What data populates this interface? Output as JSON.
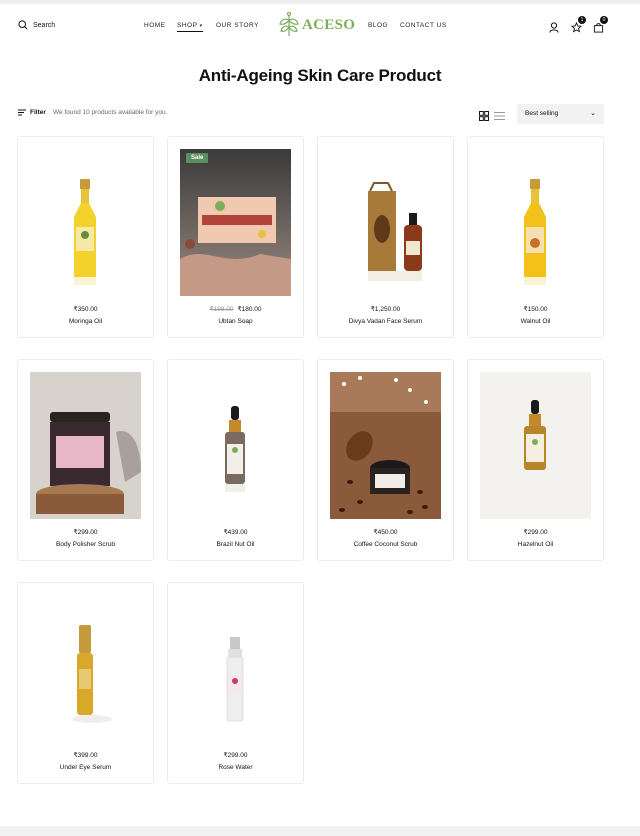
{
  "header": {
    "search_label": "Search",
    "nav_left": [
      "HOME",
      "SHOP",
      "OUR STORY"
    ],
    "nav_right": [
      "BLOG",
      "CONTACT US"
    ],
    "logo_text": "ACESO",
    "wishlist_count": "1",
    "cart_count": "0"
  },
  "page": {
    "title": "Anti-Ageing Skin Care Product",
    "filter_label": "Filter",
    "count_text": "We found 10 products available for you.",
    "sort_selected": "Best selling"
  },
  "products": [
    {
      "name": "Moringa Oil",
      "price": "₹350.00",
      "old_price": "",
      "sale": ""
    },
    {
      "name": "Ubtan Soap",
      "price": "₹180.00",
      "old_price": "₹198.00",
      "sale": "Sale"
    },
    {
      "name": "Divya Vadan Face Serum",
      "price": "₹1,250.00",
      "old_price": "",
      "sale": ""
    },
    {
      "name": "Walnut Oil",
      "price": "₹150.00",
      "old_price": "",
      "sale": ""
    },
    {
      "name": "Body Polisher Scrub",
      "price": "₹299.00",
      "old_price": "",
      "sale": ""
    },
    {
      "name": "Brazil Nut Oil",
      "price": "₹439.00",
      "old_price": "",
      "sale": ""
    },
    {
      "name": "Coffee Coconut Scrub",
      "price": "₹450.00",
      "old_price": "",
      "sale": ""
    },
    {
      "name": "Hazelnut Oil",
      "price": "₹299.00",
      "old_price": "",
      "sale": ""
    },
    {
      "name": "Under Eye Serum",
      "price": "₹399.00",
      "old_price": "",
      "sale": ""
    },
    {
      "name": "Rose Water",
      "price": "₹299.00",
      "old_price": "",
      "sale": ""
    }
  ],
  "image_labels": {
    "soap_brand": "ACESO",
    "soap_name": "UBTAN SOAP",
    "scrub_name": "BODY POLISHER SCRUB"
  },
  "colors": {
    "brand_green": "#7cae5a",
    "sale_badge": "#5b8f60"
  }
}
